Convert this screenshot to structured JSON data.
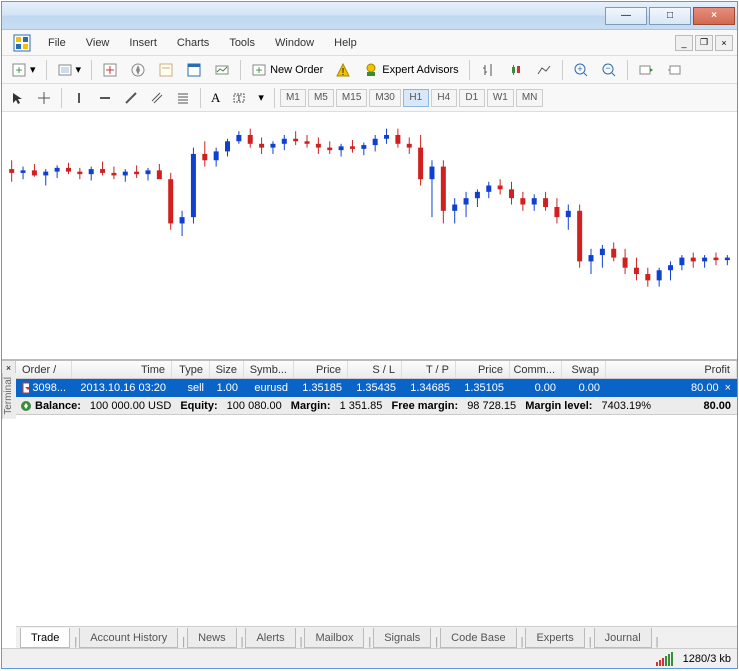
{
  "window": {
    "minimize": "—",
    "maximize": "□",
    "close": "×"
  },
  "menu": {
    "file": "File",
    "view": "View",
    "insert": "Insert",
    "charts": "Charts",
    "tools": "Tools",
    "window": "Window",
    "help": "Help"
  },
  "mdi": {
    "minimize": "_",
    "restore": "❐",
    "close": "×"
  },
  "toolbar1": {
    "new_order": "New Order",
    "expert_advisors": "Expert Advisors"
  },
  "toolbar2": {
    "text_label": "A",
    "timeframes": [
      "M1",
      "M5",
      "M15",
      "M30",
      "H1",
      "H4",
      "D1",
      "W1",
      "MN"
    ],
    "active_tf": "H1"
  },
  "terminal": {
    "label": "Terminal",
    "close": "×",
    "headers": {
      "order": "Order",
      "time": "Time",
      "type": "Type",
      "size": "Size",
      "symbol": "Symb...",
      "price": "Price",
      "sl": "S / L",
      "tp": "T / P",
      "price2": "Price",
      "comm": "Comm...",
      "swap": "Swap",
      "profit": "Profit"
    },
    "row": {
      "order": "3098...",
      "time": "2013.10.16 03:20",
      "type": "sell",
      "size": "1.00",
      "symbol": "eurusd",
      "price": "1.35185",
      "sl": "1.35435",
      "tp": "1.34685",
      "price2": "1.35105",
      "comm": "0.00",
      "swap": "0.00",
      "profit": "80.00",
      "close": "×"
    },
    "summary": {
      "balance_label": "Balance:",
      "balance": "100 000.00 USD",
      "equity_label": "Equity:",
      "equity": "100 080.00",
      "margin_label": "Margin:",
      "margin": "1 351.85",
      "free_margin_label": "Free margin:",
      "free_margin": "98 728.15",
      "margin_level_label": "Margin level:",
      "margin_level": "7403.19%",
      "profit": "80.00"
    },
    "tabs": [
      "Trade",
      "Account History",
      "News",
      "Alerts",
      "Mailbox",
      "Signals",
      "Code Base",
      "Experts",
      "Journal"
    ],
    "active_tab": 0
  },
  "statusbar": {
    "traffic": "1280/3 kb"
  },
  "chart_data": {
    "type": "candlestick",
    "note": "price candlesticks, approximate OHLC over range ~1.348-1.360",
    "candles": [
      {
        "o": 1.3538,
        "h": 1.3545,
        "l": 1.3528,
        "c": 1.3535
      },
      {
        "o": 1.3535,
        "h": 1.354,
        "l": 1.353,
        "c": 1.3537
      },
      {
        "o": 1.3537,
        "h": 1.3542,
        "l": 1.3532,
        "c": 1.3533
      },
      {
        "o": 1.3533,
        "h": 1.3538,
        "l": 1.3525,
        "c": 1.3536
      },
      {
        "o": 1.3536,
        "h": 1.3541,
        "l": 1.3531,
        "c": 1.3539
      },
      {
        "o": 1.3539,
        "h": 1.3543,
        "l": 1.3534,
        "c": 1.3536
      },
      {
        "o": 1.3536,
        "h": 1.3539,
        "l": 1.353,
        "c": 1.3534
      },
      {
        "o": 1.3534,
        "h": 1.354,
        "l": 1.3529,
        "c": 1.3538
      },
      {
        "o": 1.3538,
        "h": 1.3544,
        "l": 1.3533,
        "c": 1.3535
      },
      {
        "o": 1.3535,
        "h": 1.354,
        "l": 1.353,
        "c": 1.3533
      },
      {
        "o": 1.3533,
        "h": 1.3538,
        "l": 1.3528,
        "c": 1.3536
      },
      {
        "o": 1.3536,
        "h": 1.3541,
        "l": 1.3531,
        "c": 1.3534
      },
      {
        "o": 1.3534,
        "h": 1.3539,
        "l": 1.3529,
        "c": 1.3537
      },
      {
        "o": 1.3537,
        "h": 1.3542,
        "l": 1.3532,
        "c": 1.353
      },
      {
        "o": 1.353,
        "h": 1.3535,
        "l": 1.349,
        "c": 1.3495
      },
      {
        "o": 1.3495,
        "h": 1.3505,
        "l": 1.3485,
        "c": 1.35
      },
      {
        "o": 1.35,
        "h": 1.3555,
        "l": 1.3495,
        "c": 1.355
      },
      {
        "o": 1.355,
        "h": 1.356,
        "l": 1.354,
        "c": 1.3545
      },
      {
        "o": 1.3545,
        "h": 1.3555,
        "l": 1.354,
        "c": 1.3552
      },
      {
        "o": 1.3552,
        "h": 1.3562,
        "l": 1.3548,
        "c": 1.356
      },
      {
        "o": 1.356,
        "h": 1.3568,
        "l": 1.3558,
        "c": 1.3565
      },
      {
        "o": 1.3565,
        "h": 1.357,
        "l": 1.3555,
        "c": 1.3558
      },
      {
        "o": 1.3558,
        "h": 1.3563,
        "l": 1.355,
        "c": 1.3555
      },
      {
        "o": 1.3555,
        "h": 1.356,
        "l": 1.355,
        "c": 1.3558
      },
      {
        "o": 1.3558,
        "h": 1.3565,
        "l": 1.3553,
        "c": 1.3562
      },
      {
        "o": 1.3562,
        "h": 1.3568,
        "l": 1.3557,
        "c": 1.356
      },
      {
        "o": 1.356,
        "h": 1.3565,
        "l": 1.3555,
        "c": 1.3558
      },
      {
        "o": 1.3558,
        "h": 1.3563,
        "l": 1.355,
        "c": 1.3555
      },
      {
        "o": 1.3555,
        "h": 1.356,
        "l": 1.355,
        "c": 1.3553
      },
      {
        "o": 1.3553,
        "h": 1.3558,
        "l": 1.3548,
        "c": 1.3556
      },
      {
        "o": 1.3556,
        "h": 1.3561,
        "l": 1.3551,
        "c": 1.3554
      },
      {
        "o": 1.3554,
        "h": 1.3559,
        "l": 1.3549,
        "c": 1.3557
      },
      {
        "o": 1.3557,
        "h": 1.3565,
        "l": 1.3552,
        "c": 1.3562
      },
      {
        "o": 1.3562,
        "h": 1.357,
        "l": 1.3558,
        "c": 1.3565
      },
      {
        "o": 1.3565,
        "h": 1.357,
        "l": 1.3555,
        "c": 1.3558
      },
      {
        "o": 1.3558,
        "h": 1.3563,
        "l": 1.355,
        "c": 1.3555
      },
      {
        "o": 1.3555,
        "h": 1.3565,
        "l": 1.3525,
        "c": 1.353
      },
      {
        "o": 1.353,
        "h": 1.3545,
        "l": 1.35,
        "c": 1.354
      },
      {
        "o": 1.354,
        "h": 1.3545,
        "l": 1.3495,
        "c": 1.3505
      },
      {
        "o": 1.3505,
        "h": 1.3515,
        "l": 1.3495,
        "c": 1.351
      },
      {
        "o": 1.351,
        "h": 1.352,
        "l": 1.35,
        "c": 1.3515
      },
      {
        "o": 1.3515,
        "h": 1.3522,
        "l": 1.3508,
        "c": 1.352
      },
      {
        "o": 1.352,
        "h": 1.3528,
        "l": 1.3515,
        "c": 1.3525
      },
      {
        "o": 1.3525,
        "h": 1.353,
        "l": 1.3518,
        "c": 1.3522
      },
      {
        "o": 1.3522,
        "h": 1.3528,
        "l": 1.351,
        "c": 1.3515
      },
      {
        "o": 1.3515,
        "h": 1.352,
        "l": 1.3505,
        "c": 1.351
      },
      {
        "o": 1.351,
        "h": 1.3518,
        "l": 1.3505,
        "c": 1.3515
      },
      {
        "o": 1.3515,
        "h": 1.352,
        "l": 1.3505,
        "c": 1.3508
      },
      {
        "o": 1.3508,
        "h": 1.3515,
        "l": 1.3495,
        "c": 1.35
      },
      {
        "o": 1.35,
        "h": 1.351,
        "l": 1.349,
        "c": 1.3505
      },
      {
        "o": 1.3505,
        "h": 1.351,
        "l": 1.346,
        "c": 1.3465
      },
      {
        "o": 1.3465,
        "h": 1.3475,
        "l": 1.3455,
        "c": 1.347
      },
      {
        "o": 1.347,
        "h": 1.3478,
        "l": 1.346,
        "c": 1.3475
      },
      {
        "o": 1.3475,
        "h": 1.348,
        "l": 1.3465,
        "c": 1.3468
      },
      {
        "o": 1.3468,
        "h": 1.3475,
        "l": 1.3455,
        "c": 1.346
      },
      {
        "o": 1.346,
        "h": 1.3468,
        "l": 1.345,
        "c": 1.3455
      },
      {
        "o": 1.3455,
        "h": 1.346,
        "l": 1.3445,
        "c": 1.345
      },
      {
        "o": 1.345,
        "h": 1.346,
        "l": 1.3445,
        "c": 1.3458
      },
      {
        "o": 1.3458,
        "h": 1.3465,
        "l": 1.345,
        "c": 1.3462
      },
      {
        "o": 1.3462,
        "h": 1.347,
        "l": 1.3458,
        "c": 1.3468
      },
      {
        "o": 1.3468,
        "h": 1.3472,
        "l": 1.346,
        "c": 1.3465
      },
      {
        "o": 1.3465,
        "h": 1.347,
        "l": 1.346,
        "c": 1.3468
      },
      {
        "o": 1.3468,
        "h": 1.3472,
        "l": 1.3462,
        "c": 1.3466
      },
      {
        "o": 1.3466,
        "h": 1.347,
        "l": 1.3462,
        "c": 1.3468
      }
    ],
    "ylim": [
      1.344,
      1.358
    ]
  }
}
